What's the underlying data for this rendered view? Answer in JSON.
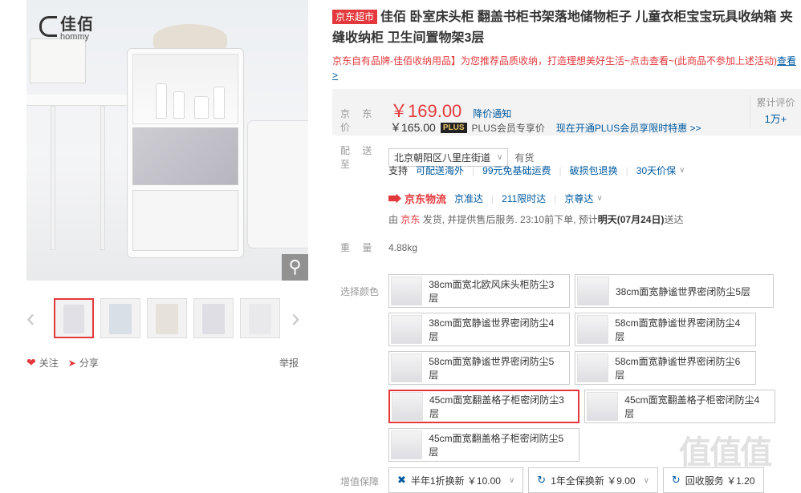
{
  "gallery": {
    "brand_cn": "佳佰",
    "brand_en": "hommy",
    "thumbs_count": 5,
    "actions": {
      "follow": "关注",
      "share": "分享",
      "report": "举报"
    }
  },
  "product": {
    "store_tag": "京东超市",
    "title": "佳佰 卧室床头柜 翻盖书柜书架落地储物柜子 儿童衣柜宝宝玩具收纳箱 夹缝收纳柜 卫生间置物架3层",
    "promo_text": "京东自有品牌-佳佰收纳用品】为您推荐品质收纳，打造理想美好生活~点击查看~(此商品不参加上述活动)",
    "promo_link": "查看>"
  },
  "price": {
    "label": "京 东 价",
    "value": "￥169.00",
    "notice": "降价通知",
    "plus_price": "￥165.00",
    "plus_badge": "PLUS",
    "plus_text": "PLUS会员专享价",
    "plus_link": "现在开通PLUS会员享限时特惠 >>",
    "reviews_label": "累计评价",
    "reviews_count": "1万+"
  },
  "delivery": {
    "label": "配 送 至",
    "address": "北京朝阳区八里庄街道",
    "stock": "有货",
    "support_label": "支持",
    "services": [
      "可配送海外",
      "99元免基础运费",
      "破损包退换",
      "30天价保"
    ],
    "logistics_brand": "京东物流",
    "logistics_opts": [
      "京准达",
      "211限时达",
      "京尊达"
    ],
    "note_prefix": "由",
    "note_seller": "京东",
    "note_body": "发货, 并提供售后服务. 23:10前下单, 预计",
    "note_date": "明天(07月24日)",
    "note_suffix": "送达"
  },
  "weight": {
    "label": "重 量",
    "value": "4.88kg"
  },
  "colors": {
    "label": "选择颜色",
    "options": [
      "38cm面宽北欧风床头柜防尘3层",
      "38cm面宽静谧世界密闭防尘5层",
      "38cm面宽静谧世界密闭防尘4层",
      "58cm面宽静谧世界密闭防尘4层",
      "58cm面宽静谧世界密闭防尘5层",
      "58cm面宽静谧世界密闭防尘6层",
      "45cm面宽翻盖格子柜密闭防尘3层",
      "45cm面宽翻盖格子柜密闭防尘4层",
      "45cm面宽翻盖格子柜密闭防尘5层"
    ],
    "selected_index": 6
  },
  "guarantee": {
    "label": "增值保障",
    "options": [
      "半年1折换新 ￥10.00",
      "1年全保换新 ￥9.00",
      "回收服务 ￥1.20"
    ]
  },
  "watermark": "值值值"
}
